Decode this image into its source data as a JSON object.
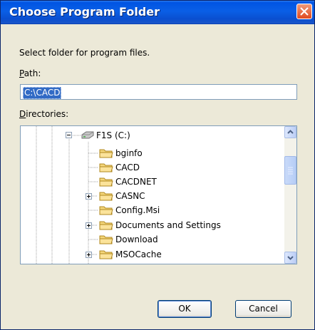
{
  "dialog": {
    "title": "Choose Program Folder",
    "instructions": "Select folder for program files.",
    "path_label_accel": "P",
    "path_label_rest": "ath:",
    "path_value": "C:\\CACD",
    "directories_label_accel": "D",
    "directories_label_rest": "irectories:"
  },
  "tree": {
    "drive": {
      "label": "F1S (C:)",
      "icon": "hard-drive-icon"
    },
    "items": [
      {
        "label": "bginfo",
        "expandable": false
      },
      {
        "label": "CACD",
        "expandable": false
      },
      {
        "label": "CACDNET",
        "expandable": false
      },
      {
        "label": "CASNC",
        "expandable": true
      },
      {
        "label": "Config.Msi",
        "expandable": false
      },
      {
        "label": "Documents and Settings",
        "expandable": true
      },
      {
        "label": "Download",
        "expandable": false
      },
      {
        "label": "MSOCache",
        "expandable": true
      }
    ]
  },
  "buttons": {
    "ok": "OK",
    "cancel": "Cancel"
  },
  "colors": {
    "titlebar": "#0054e3",
    "selection": "#316ac5",
    "dialog_bg": "#ece9d8"
  }
}
